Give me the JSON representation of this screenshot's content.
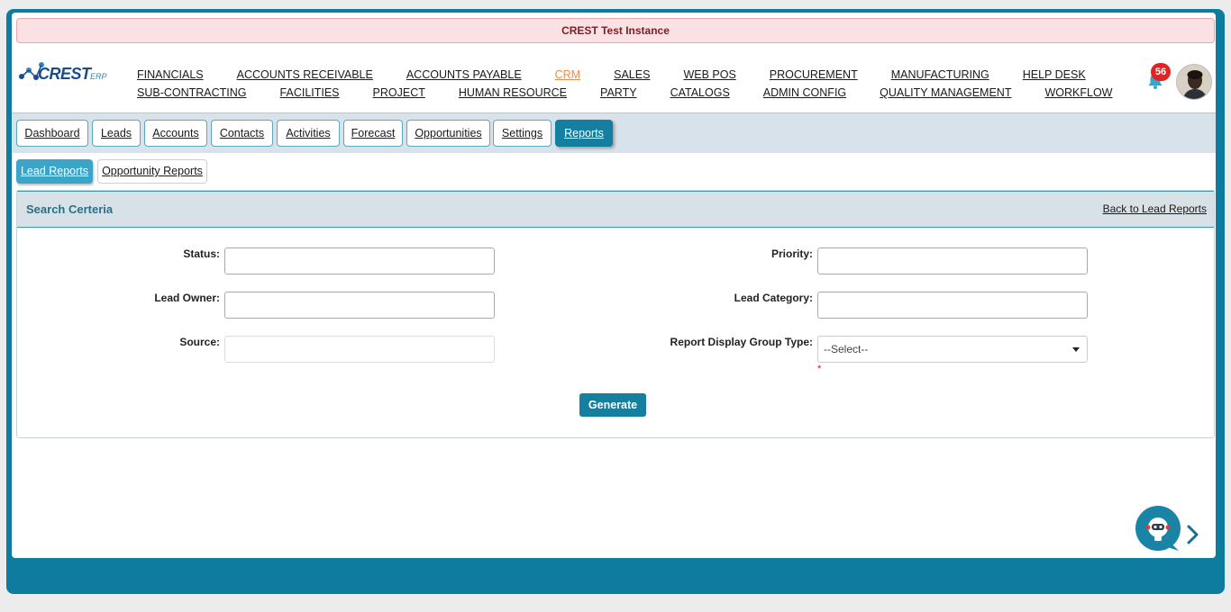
{
  "banner": {
    "text": "CREST Test Instance"
  },
  "logo": {
    "name": "CREST",
    "suffix": "ERP"
  },
  "topnav": {
    "row1": [
      {
        "label": "FINANCIALS",
        "active": false
      },
      {
        "label": "ACCOUNTS RECEIVABLE",
        "active": false
      },
      {
        "label": "ACCOUNTS PAYABLE",
        "active": false
      },
      {
        "label": "CRM",
        "active": true
      },
      {
        "label": "SALES",
        "active": false
      },
      {
        "label": "WEB POS",
        "active": false
      },
      {
        "label": "PROCUREMENT",
        "active": false
      },
      {
        "label": "MANUFACTURING",
        "active": false
      },
      {
        "label": "HELP DESK",
        "active": false
      }
    ],
    "row2": [
      {
        "label": "SUB-CONTRACTING",
        "active": false
      },
      {
        "label": "FACILITIES",
        "active": false
      },
      {
        "label": "PROJECT",
        "active": false
      },
      {
        "label": "HUMAN RESOURCE",
        "active": false
      },
      {
        "label": "PARTY",
        "active": false
      },
      {
        "label": "CATALOGS",
        "active": false
      },
      {
        "label": "ADMIN CONFIG",
        "active": false
      },
      {
        "label": "QUALITY MANAGEMENT",
        "active": false
      },
      {
        "label": "WORKFLOW",
        "active": false
      }
    ]
  },
  "notifications": {
    "count": "56",
    "icon": "bell-icon"
  },
  "tabs": [
    {
      "label": "Dashboard"
    },
    {
      "label": "Leads"
    },
    {
      "label": "Accounts"
    },
    {
      "label": "Contacts"
    },
    {
      "label": "Activities"
    },
    {
      "label": "Forecast"
    },
    {
      "label": "Opportunities"
    },
    {
      "label": "Settings"
    },
    {
      "label": "Reports",
      "active": true
    }
  ],
  "subtabs": [
    {
      "label": "Lead Reports",
      "active": true
    },
    {
      "label": "Opportunity Reports",
      "active": false
    }
  ],
  "panel": {
    "title": "Search Certeria",
    "back_link": "Back to Lead Reports"
  },
  "form": {
    "status_label": "Status:",
    "status_value": "",
    "lead_owner_label": "Lead Owner:",
    "lead_owner_value": "",
    "source_label": "Source:",
    "source_value": "",
    "priority_label": "Priority:",
    "priority_value": "",
    "lead_category_label": "Lead Category:",
    "lead_category_value": "",
    "display_group_label": "Report Display Group Type:",
    "display_group_value": "--Select--",
    "required_mark": "*",
    "generate_label": "Generate"
  },
  "colors": {
    "primary": "#147f9f",
    "active_module": "#f08a4b",
    "badge": "#e32222",
    "banner_bg": "#fbe1e3"
  }
}
